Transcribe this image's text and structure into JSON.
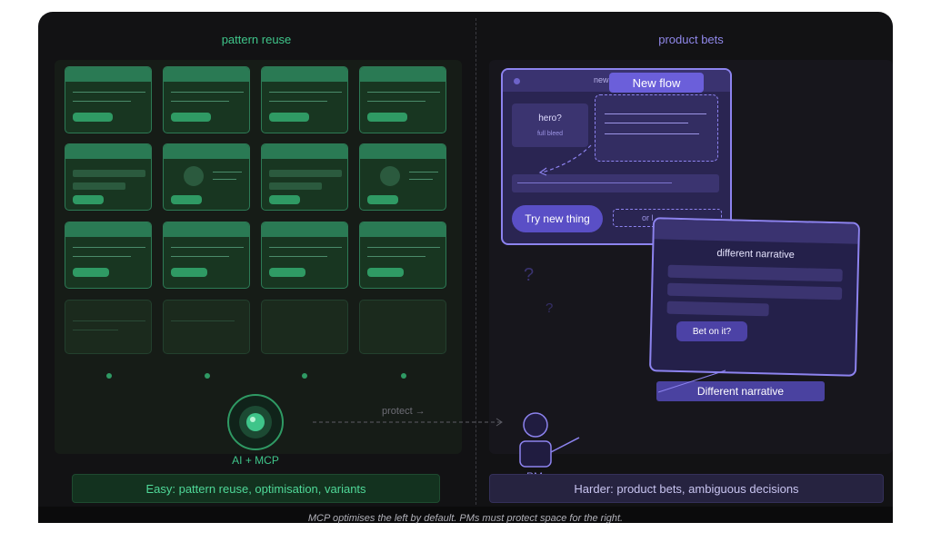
{
  "left_heading": "pattern reuse",
  "right_heading": "product bets",
  "ai_label": "AI + MCP",
  "protect_label": "protect →",
  "pm_label": "PM",
  "left_footer": "Easy: pattern reuse, optimisation, variants",
  "right_footer": "Harder: product bets, ambiguous decisions",
  "caption": "MCP optimises the left by default. PMs must protect space for the right.",
  "window1": {
    "tab_label": "new",
    "flow_label": "New flow",
    "hero_title": "hero?",
    "hero_subtitle": "full bleed",
    "try_button": "Try new thing",
    "dashed_label": "or l"
  },
  "window2": {
    "title": "different narrative",
    "bet_button": "Bet on it?"
  },
  "narrative_label": "Different narrative",
  "question_mark_1": "?",
  "question_mark_2": "?",
  "colors": {
    "left_accent": "#3fc58a",
    "right_accent": "#9088ea",
    "background": "#121214"
  }
}
